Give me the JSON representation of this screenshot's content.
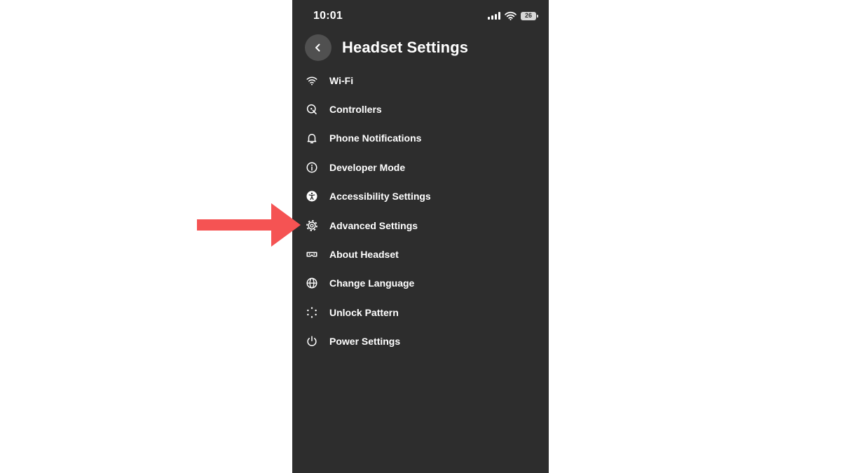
{
  "status_bar": {
    "time": "10:01",
    "battery_level": "26",
    "icons": [
      "signal-icon",
      "wifi-icon",
      "battery-icon"
    ]
  },
  "header": {
    "title": "Headset Settings",
    "back_icon": "chevron-left-icon"
  },
  "menu": {
    "items": [
      {
        "label": "Wi-Fi",
        "icon": "wifi-icon"
      },
      {
        "label": "Controllers",
        "icon": "controller-icon"
      },
      {
        "label": "Phone Notifications",
        "icon": "bell-icon"
      },
      {
        "label": "Developer Mode",
        "icon": "info-icon"
      },
      {
        "label": "Accessibility Settings",
        "icon": "accessibility-icon"
      },
      {
        "label": "Advanced Settings",
        "icon": "gear-icon"
      },
      {
        "label": "About Headset",
        "icon": "headset-icon"
      },
      {
        "label": "Change Language",
        "icon": "globe-icon"
      },
      {
        "label": "Unlock Pattern",
        "icon": "dot-pattern-icon"
      },
      {
        "label": "Power Settings",
        "icon": "power-icon"
      }
    ]
  },
  "annotation": {
    "type": "arrow",
    "points_to": "Advanced Settings",
    "color": "#f55353"
  },
  "colors": {
    "app_background": "#2d2d2d",
    "page_background": "#ffffff",
    "text": "#ffffff",
    "back_button": "#505050"
  }
}
